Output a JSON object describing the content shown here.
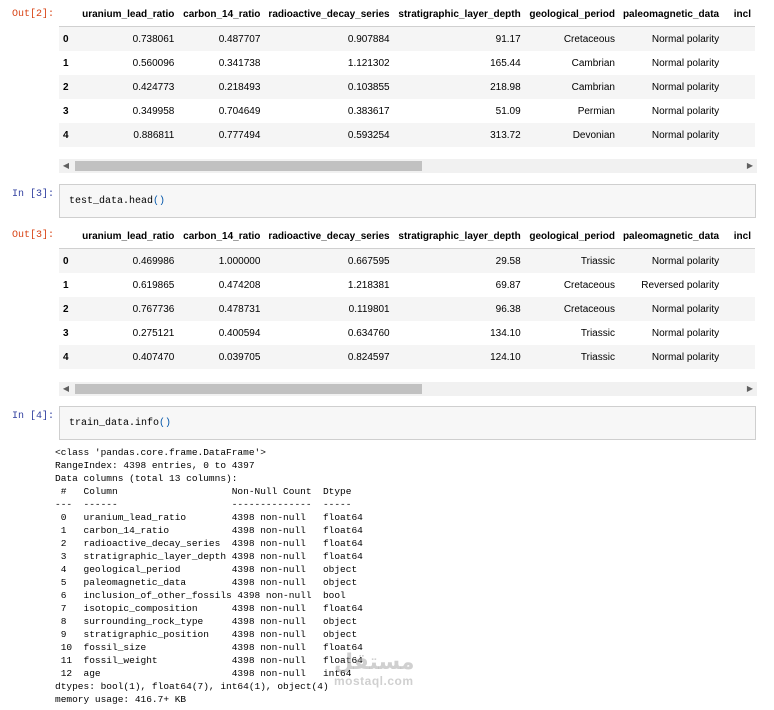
{
  "prompts": {
    "out2": "Out[2]:",
    "in3": "In [3]:",
    "out3": "Out[3]:",
    "in4": "In [4]:"
  },
  "table_columns": [
    "",
    "uranium_lead_ratio",
    "carbon_14_ratio",
    "radioactive_decay_series",
    "stratigraphic_layer_depth",
    "geological_period",
    "paleomagnetic_data",
    "incl"
  ],
  "out2_rows": [
    [
      "0",
      "0.738061",
      "0.487707",
      "0.907884",
      "91.17",
      "Cretaceous",
      "Normal polarity"
    ],
    [
      "1",
      "0.560096",
      "0.341738",
      "1.121302",
      "165.44",
      "Cambrian",
      "Normal polarity"
    ],
    [
      "2",
      "0.424773",
      "0.218493",
      "0.103855",
      "218.98",
      "Cambrian",
      "Normal polarity"
    ],
    [
      "3",
      "0.349958",
      "0.704649",
      "0.383617",
      "51.09",
      "Permian",
      "Normal polarity"
    ],
    [
      "4",
      "0.886811",
      "0.777494",
      "0.593254",
      "313.72",
      "Devonian",
      "Normal polarity"
    ]
  ],
  "out3_rows": [
    [
      "0",
      "0.469986",
      "1.000000",
      "0.667595",
      "29.58",
      "Triassic",
      "Normal polarity"
    ],
    [
      "1",
      "0.619865",
      "0.474208",
      "1.218381",
      "69.87",
      "Cretaceous",
      "Reversed polarity"
    ],
    [
      "2",
      "0.767736",
      "0.478731",
      "0.119801",
      "96.38",
      "Cretaceous",
      "Normal polarity"
    ],
    [
      "3",
      "0.275121",
      "0.400594",
      "0.634760",
      "134.10",
      "Triassic",
      "Normal polarity"
    ],
    [
      "4",
      "0.407470",
      "0.039705",
      "0.824597",
      "124.10",
      "Triassic",
      "Normal polarity"
    ]
  ],
  "cell3": {
    "fn": "test_data.head",
    "parens": "()"
  },
  "cell4": {
    "fn": "train_data.info",
    "parens": "()"
  },
  "info_lines": [
    "<class 'pandas.core.frame.DataFrame'>",
    "RangeIndex: 4398 entries, 0 to 4397",
    "Data columns (total 13 columns):",
    " #   Column                    Non-Null Count  Dtype  ",
    "---  ------                    --------------  -----  ",
    " 0   uranium_lead_ratio        4398 non-null   float64",
    " 1   carbon_14_ratio           4398 non-null   float64",
    " 2   radioactive_decay_series  4398 non-null   float64",
    " 3   stratigraphic_layer_depth 4398 non-null   float64",
    " 4   geological_period         4398 non-null   object ",
    " 5   paleomagnetic_data        4398 non-null   object ",
    " 6   inclusion_of_other_fossils 4398 non-null  bool   ",
    " 7   isotopic_composition      4398 non-null   float64",
    " 8   surrounding_rock_type     4398 non-null   object ",
    " 9   stratigraphic_position    4398 non-null   object ",
    " 10  fossil_size               4398 non-null   float64",
    " 11  fossil_weight             4398 non-null   float64",
    " 12  age                       4398 non-null   int64  ",
    "dtypes: bool(1), float64(7), int64(1), object(4)",
    "memory usage: 416.7+ KB"
  ],
  "scroll_icons": {
    "left": "triangle-left-icon",
    "right": "triangle-right-icon"
  },
  "watermark": {
    "arabic": "مستقل",
    "latin": "mostaql.com"
  }
}
